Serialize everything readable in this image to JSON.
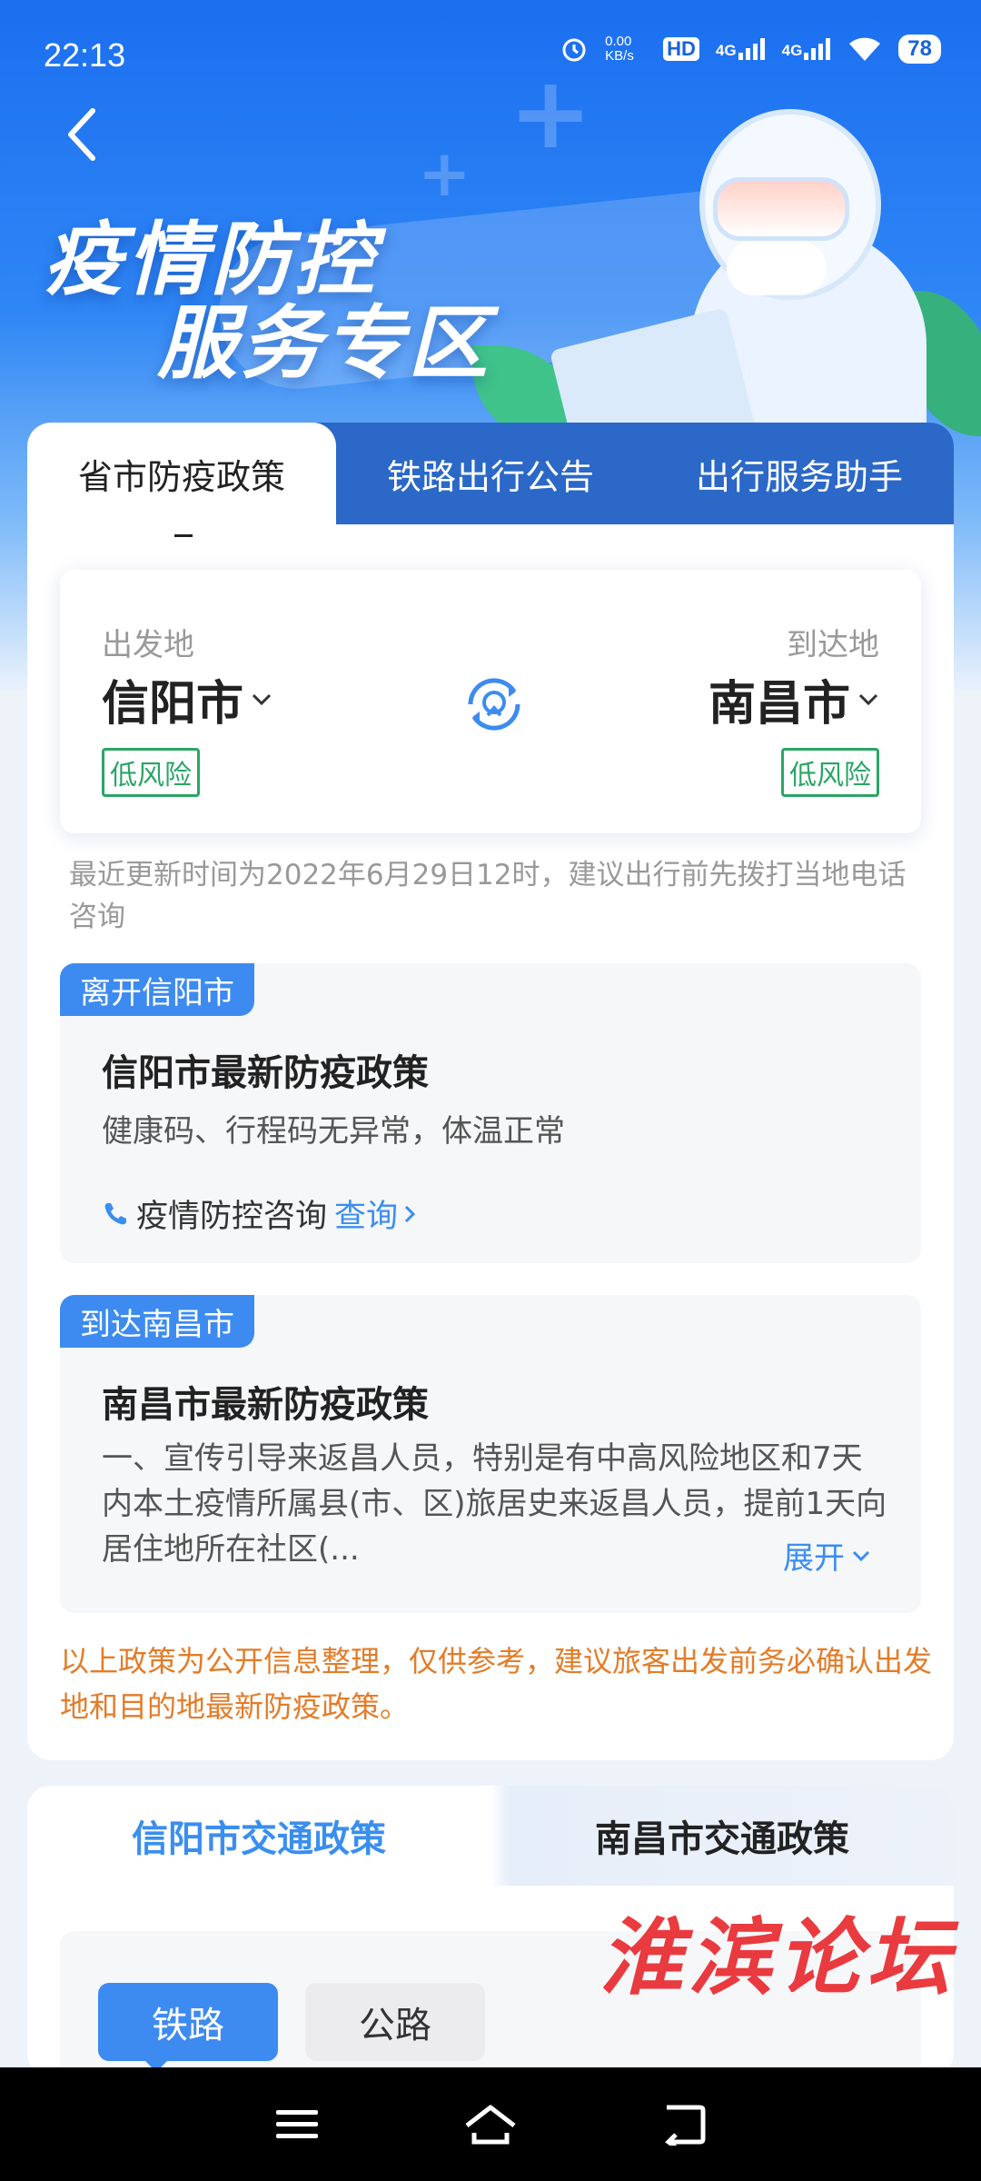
{
  "status_bar": {
    "time": "22:13",
    "net_speed": "0.00 KB/s",
    "hd": "HD",
    "sig1": "4G",
    "sig2": "4G",
    "battery": "78"
  },
  "header": {
    "title_line1": "疫情防控",
    "title_line2": "服务专区"
  },
  "tabs": [
    {
      "label": "省市防疫政策",
      "active": true
    },
    {
      "label": "铁路出行公告",
      "active": false
    },
    {
      "label": "出行服务助手",
      "active": false
    }
  ],
  "route": {
    "from_label": "出发地",
    "from_city": "信阳市",
    "from_risk": "低风险",
    "to_label": "到达地",
    "to_city": "南昌市",
    "to_risk": "低风险"
  },
  "update_note": "最近更新时间为2022年6月29日12时，建议出行前先拨打当地电话咨询",
  "leave_policy": {
    "badge": "离开信阳市",
    "title": "信阳市最新防疫政策",
    "text": "健康码、行程码无异常，体温正常",
    "consult_label": "疫情防控咨询",
    "consult_link": "查询"
  },
  "arrive_policy": {
    "badge": "到达南昌市",
    "title": "南昌市最新防疫政策",
    "text": "一、宣传引导来返昌人员，特别是有中高风险地区和7天内本土疫情所属县(市、区)旅居史来返昌人员，提前1天向居住地所在社区(...",
    "expand": "展开"
  },
  "disclaimer": "以上政策为公开信息整理，仅供参考，建议旅客出发前务必确认出发地和目的地最新防疫政策。",
  "traffic": {
    "tabs": [
      {
        "label": "信阳市交通政策",
        "active": true
      },
      {
        "label": "南昌市交通政策",
        "active": false
      }
    ],
    "modes": [
      {
        "label": "铁路",
        "active": true
      },
      {
        "label": "公路",
        "active": false
      }
    ]
  },
  "watermark": "淮滨论坛",
  "colors": {
    "primary": "#3d8bf0",
    "tab_bar": "#2b68c8",
    "risk_green": "#2aa565",
    "warning_orange": "#e37c28",
    "watermark_red": "#e8262b"
  }
}
